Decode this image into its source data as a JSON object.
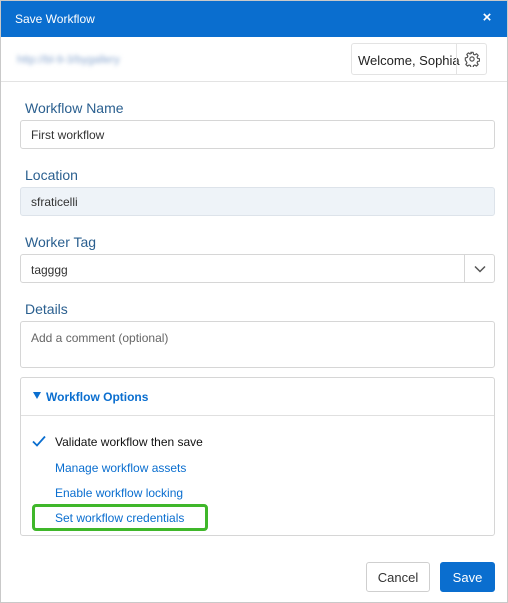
{
  "dialog": {
    "title": "Save Workflow",
    "close_glyph": "×",
    "close_icon": "close-icon"
  },
  "header": {
    "url": "http://bl-9-3/bygallery",
    "welcome": "Welcome, Sophia",
    "settings_icon": "gear-icon"
  },
  "form": {
    "workflow_name": {
      "label": "Workflow Name",
      "value": "First workflow"
    },
    "location": {
      "label": "Location",
      "value": "sfraticelli"
    },
    "worker_tag": {
      "label": "Worker Tag",
      "value": "tagggg",
      "arrow_icon": "chevron-down-icon"
    },
    "details": {
      "label": "Details",
      "placeholder": "Add a comment (optional)",
      "value": ""
    }
  },
  "options": {
    "title": "Workflow Options",
    "expanded": true,
    "validate_label": "Validate workflow then save",
    "validate_checked": true,
    "links": {
      "manage_assets": "Manage workflow assets",
      "enable_locking": "Enable workflow locking",
      "set_credentials": "Set workflow credentials"
    },
    "highlight_color": "#3fb72a"
  },
  "buttons": {
    "cancel": "Cancel",
    "save": "Save"
  },
  "colors": {
    "accent": "#0a6ecf",
    "label": "#2a5f8f"
  }
}
